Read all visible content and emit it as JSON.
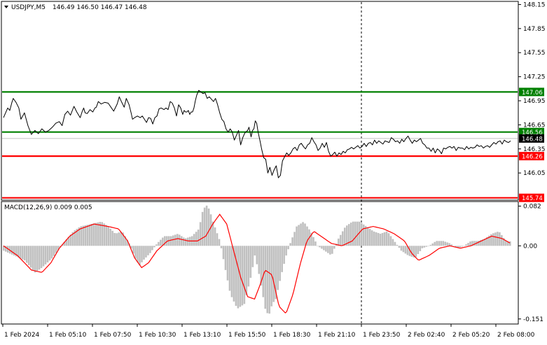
{
  "chart_data": {
    "type": "line",
    "header": {
      "symbol": "USDJPY,M5",
      "ohlc": "146.49 146.50 146.47 146.48"
    },
    "price_axis": {
      "ylim": [
        145.72,
        148.18
      ],
      "ticks": [
        "148.15",
        "147.85",
        "147.55",
        "147.25",
        "146.95",
        "146.65",
        "146.35",
        "146.05"
      ]
    },
    "level_lines": [
      {
        "value": 147.06,
        "label": "147.06",
        "color": "#008000"
      },
      {
        "value": 146.56,
        "label": "146.56",
        "color": "#008000"
      },
      {
        "value": 146.26,
        "label": "146.26",
        "color": "#ff0000"
      },
      {
        "value": 145.74,
        "label": "145.74",
        "color": "#ff0000"
      }
    ],
    "bid_line": {
      "value": 146.48,
      "label": "146.48",
      "color": "#c0c0c0"
    },
    "price_series": {
      "name": "USDJPY",
      "x": [
        0,
        3,
        6,
        9,
        12,
        14,
        18,
        22,
        25,
        30,
        35,
        40,
        45,
        50,
        55,
        60,
        65,
        70,
        75,
        80,
        84,
        88,
        92,
        96,
        101,
        105,
        110,
        113,
        115,
        117,
        120,
        124,
        128,
        131,
        133,
        136,
        140,
        145,
        150,
        154,
        158,
        163,
        166,
        169,
        173,
        176,
        180,
        183,
        185,
        188,
        192,
        196,
        199,
        202,
        205,
        208,
        211,
        214,
        217,
        220,
        223,
        226,
        230,
        233,
        236,
        239,
        242,
        245,
        248,
        251,
        254,
        257,
        259,
        261,
        263,
        265,
        267,
        269,
        271,
        273,
        275,
        277,
        280,
        283,
        286,
        289,
        292,
        295,
        298,
        301,
        304,
        307,
        310,
        313,
        316,
        319,
        322,
        325,
        328,
        331,
        334,
        337,
        340,
        343,
        346,
        350,
        352,
        355,
        357,
        359,
        361,
        363,
        365,
        368,
        370,
        373,
        376,
        379,
        382,
        385,
        388,
        391,
        394,
        397,
        400,
        403,
        406,
        409,
        412,
        415,
        418,
        421,
        424,
        427,
        430,
        433,
        436,
        439,
        442,
        445,
        448,
        451,
        454,
        457,
        460,
        463,
        466,
        469,
        472,
        475,
        478,
        481,
        484,
        487,
        490,
        493,
        496,
        499,
        502,
        505,
        508,
        511,
        514,
        517,
        520,
        523,
        526,
        529,
        532,
        535,
        538,
        541,
        544,
        547,
        550,
        553,
        556,
        559,
        562,
        565,
        568,
        571,
        574,
        577,
        580,
        583,
        586,
        589,
        592,
        595,
        598,
        601,
        604,
        607,
        610,
        613,
        616,
        619,
        622,
        625,
        628,
        631,
        634,
        637,
        640,
        643,
        646,
        649,
        652,
        655,
        658,
        661,
        664,
        667,
        670,
        673,
        676,
        679,
        682,
        685,
        688,
        691,
        694,
        697,
        700,
        703,
        706,
        709,
        712,
        715,
        718,
        721,
        724,
        727
      ],
      "values": [
        146.74,
        146.8,
        146.86,
        146.83,
        146.93,
        146.98,
        146.93,
        146.86,
        146.72,
        146.8,
        146.64,
        146.53,
        146.58,
        146.54,
        146.6,
        146.56,
        146.58,
        146.62,
        146.67,
        146.69,
        146.64,
        146.78,
        146.82,
        146.77,
        146.88,
        146.81,
        146.74,
        146.82,
        146.86,
        146.8,
        146.79,
        146.84,
        146.81,
        146.86,
        146.87,
        146.94,
        146.91,
        146.93,
        146.92,
        146.87,
        146.82,
        146.91,
        147.0,
        146.94,
        146.87,
        146.98,
        146.9,
        146.8,
        146.72,
        146.74,
        146.76,
        146.74,
        146.76,
        146.72,
        146.68,
        146.74,
        146.73,
        146.66,
        146.74,
        146.76,
        146.85,
        146.86,
        146.84,
        146.86,
        146.84,
        146.94,
        146.92,
        146.86,
        146.76,
        146.9,
        146.86,
        146.78,
        146.83,
        146.81,
        146.81,
        146.83,
        146.78,
        146.81,
        146.81,
        146.86,
        146.95,
        147.02,
        147.08,
        147.06,
        147.04,
        147.05,
        146.98,
        147.0,
        146.97,
        146.94,
        146.98,
        146.9,
        146.8,
        146.72,
        146.69,
        146.6,
        146.56,
        146.6,
        146.56,
        146.46,
        146.52,
        146.58,
        146.4,
        146.49,
        146.55,
        146.58,
        146.62,
        146.5,
        146.58,
        146.6,
        146.7,
        146.67,
        146.56,
        146.44,
        146.35,
        146.24,
        146.22,
        146.05,
        146.12,
        146.02,
        146.09,
        146.14,
        145.99,
        146.02,
        146.2,
        146.25,
        146.3,
        146.27,
        146.3,
        146.35,
        146.37,
        146.33,
        146.4,
        146.42,
        146.38,
        146.35,
        146.4,
        146.42,
        146.49,
        146.44,
        146.4,
        146.33,
        146.36,
        146.42,
        146.37,
        146.43,
        146.32,
        146.26,
        146.28,
        146.31,
        146.26,
        146.3,
        146.28,
        146.32,
        146.3,
        146.34,
        146.35,
        146.37,
        146.35,
        146.37,
        146.39,
        146.36,
        146.38,
        146.42,
        146.38,
        146.42,
        146.43,
        146.4,
        146.46,
        146.42,
        146.45,
        146.43,
        146.41,
        146.45,
        146.44,
        146.43,
        146.49,
        146.47,
        146.44,
        146.45,
        146.42,
        146.47,
        146.44,
        146.48,
        146.51,
        146.46,
        146.42,
        146.46,
        146.44,
        146.46,
        146.48,
        146.42,
        146.4,
        146.36,
        146.36,
        146.32,
        146.36,
        146.3,
        146.35,
        146.33,
        146.29,
        146.36,
        146.35,
        146.37,
        146.38,
        146.36,
        146.38,
        146.33,
        146.37,
        146.36,
        146.36,
        146.34,
        146.38,
        146.35,
        146.37,
        146.36,
        146.37,
        146.4,
        146.38,
        146.39,
        146.36,
        146.38,
        146.39,
        146.37,
        146.4,
        146.43,
        146.41,
        146.44,
        146.45,
        146.41,
        146.46,
        146.44,
        146.43,
        146.45,
        146.43,
        146.37,
        146.43,
        146.41,
        146.45,
        146.43,
        146.48
      ]
    },
    "macd": {
      "label": "MACD(12,26,9) 0.009 0.005",
      "ylim": [
        -0.16,
        0.09
      ],
      "ticks": [
        {
          "value": 0.082,
          "label": "0.082"
        },
        {
          "value": 0.0,
          "label": "0.00"
        },
        {
          "value": -0.151,
          "label": "-0.151"
        }
      ],
      "histogram_color": "#c0c0c0",
      "histogram": {
        "x": [
          0,
          30,
          45,
          55,
          70,
          85,
          100,
          110,
          125,
          140,
          150,
          160,
          170,
          180,
          190,
          195,
          200,
          210,
          220,
          230,
          240,
          250,
          260,
          270,
          280,
          285,
          290,
          295,
          300,
          310,
          318,
          325,
          335,
          345,
          355,
          360,
          365,
          370,
          375,
          380,
          385,
          390,
          398,
          405,
          412,
          420,
          430,
          440,
          450,
          460,
          470,
          480,
          490,
          500,
          510,
          520,
          530,
          540,
          550,
          560,
          570,
          580,
          590,
          600,
          610,
          620,
          630,
          640,
          650,
          660,
          670,
          680,
          690,
          700,
          710,
          720,
          727
        ],
        "values": [
          -0.01,
          -0.03,
          -0.055,
          -0.045,
          -0.025,
          0.005,
          0.03,
          0.04,
          0.045,
          0.05,
          0.04,
          0.025,
          0.03,
          0.005,
          -0.03,
          -0.04,
          -0.03,
          -0.015,
          0.005,
          0.02,
          0.02,
          0.025,
          0.015,
          0.02,
          0.035,
          0.07,
          0.085,
          0.075,
          0.05,
          0.01,
          -0.05,
          -0.1,
          -0.13,
          -0.12,
          -0.06,
          -0.02,
          -0.05,
          -0.09,
          -0.13,
          -0.145,
          -0.12,
          -0.11,
          -0.06,
          -0.02,
          0.01,
          0.04,
          0.05,
          0.03,
          0.0,
          -0.01,
          -0.02,
          0.015,
          0.04,
          0.05,
          0.05,
          0.04,
          0.03,
          0.025,
          0.03,
          0.01,
          -0.01,
          -0.02,
          -0.025,
          -0.005,
          0.0,
          0.01,
          0.01,
          0.005,
          -0.005,
          0.0,
          0.01,
          0.01,
          0.015,
          0.025,
          0.03,
          0.01,
          0.009
        ]
      },
      "signal_color": "#ff0000",
      "signal": {
        "x": [
          0,
          20,
          40,
          55,
          68,
          80,
          95,
          110,
          130,
          150,
          165,
          178,
          188,
          198,
          208,
          220,
          235,
          250,
          265,
          278,
          290,
          300,
          310,
          320,
          330,
          340,
          350,
          360,
          368,
          375,
          385,
          395,
          405,
          415,
          425,
          435,
          445,
          455,
          470,
          485,
          500,
          515,
          530,
          545,
          560,
          575,
          585,
          595,
          610,
          625,
          640,
          655,
          670,
          685,
          700,
          715,
          727
        ],
        "values": [
          0.0,
          -0.02,
          -0.05,
          -0.055,
          -0.035,
          -0.005,
          0.02,
          0.035,
          0.045,
          0.04,
          0.035,
          0.01,
          -0.025,
          -0.045,
          -0.035,
          -0.01,
          0.01,
          0.015,
          0.01,
          0.01,
          0.02,
          0.045,
          0.065,
          0.045,
          -0.01,
          -0.065,
          -0.105,
          -0.11,
          -0.08,
          -0.05,
          -0.06,
          -0.125,
          -0.14,
          -0.1,
          -0.04,
          0.01,
          0.03,
          0.02,
          0.005,
          0.0,
          0.01,
          0.035,
          0.04,
          0.035,
          0.025,
          0.01,
          -0.015,
          -0.03,
          -0.02,
          -0.005,
          0.0,
          -0.005,
          0.0,
          0.01,
          0.02,
          0.015,
          0.005
        ]
      }
    },
    "x_axis": {
      "labels": [
        "1 Feb 2024",
        "1 Feb 05:10",
        "1 Feb 07:50",
        "1 Feb 10:30",
        "1 Feb 13:10",
        "1 Feb 15:50",
        "1 Feb 18:30",
        "1 Feb 21:10",
        "1 Feb 23:50",
        "2 Feb 02:40",
        "2 Feb 05:20",
        "2 Feb 08:00"
      ]
    },
    "vertical_marker": {
      "label_index": 8
    }
  }
}
